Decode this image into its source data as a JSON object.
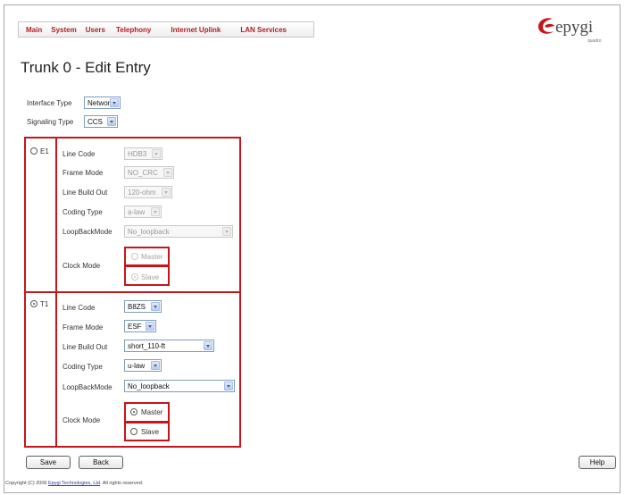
{
  "menu": [
    "Main",
    "System",
    "Users",
    "Telephony",
    "Internet Uplink",
    "LAN Services"
  ],
  "logo": {
    "brand": "epygi",
    "sub": "quadro"
  },
  "page_title": "Trunk 0 - Edit Entry",
  "interface_type": {
    "label": "Interface Type",
    "value": "Network"
  },
  "signaling_type": {
    "label": "Signaling Type",
    "value": "CCS"
  },
  "e1": {
    "label": "E1",
    "line_code": {
      "label": "Line Code",
      "value": "HDB3"
    },
    "frame_mode": {
      "label": "Frame Mode",
      "value": "NO_CRC"
    },
    "line_build_out": {
      "label": "Line Build Out",
      "value": "120-ohm"
    },
    "coding_type": {
      "label": "Coding Type",
      "value": "a-law"
    },
    "loopback_mode": {
      "label": "LoopBackMode",
      "value": "No_loopback"
    },
    "clock_mode": {
      "label": "Clock Mode",
      "master": "Master",
      "slave": "Slave"
    }
  },
  "t1": {
    "label": "T1",
    "line_code": {
      "label": "Line Code",
      "value": "B8ZS"
    },
    "frame_mode": {
      "label": "Frame Mode",
      "value": "ESF"
    },
    "line_build_out": {
      "label": "Line Build Out",
      "value": "short_110-ft"
    },
    "coding_type": {
      "label": "Coding Type",
      "value": "u-law"
    },
    "loopback_mode": {
      "label": "LoopBackMode",
      "value": "No_loopback"
    },
    "clock_mode": {
      "label": "Clock Mode",
      "master": "Master",
      "slave": "Slave"
    }
  },
  "buttons": {
    "save": "Save",
    "back": "Back",
    "help": "Help"
  },
  "footer": {
    "prefix": "Copyright (C) 2006 ",
    "link": "Epygi Technologies, Ltd",
    "suffix": ". All rights reserved."
  },
  "colors": {
    "accent": "#c4161c",
    "menu_text": "#b01e23"
  }
}
